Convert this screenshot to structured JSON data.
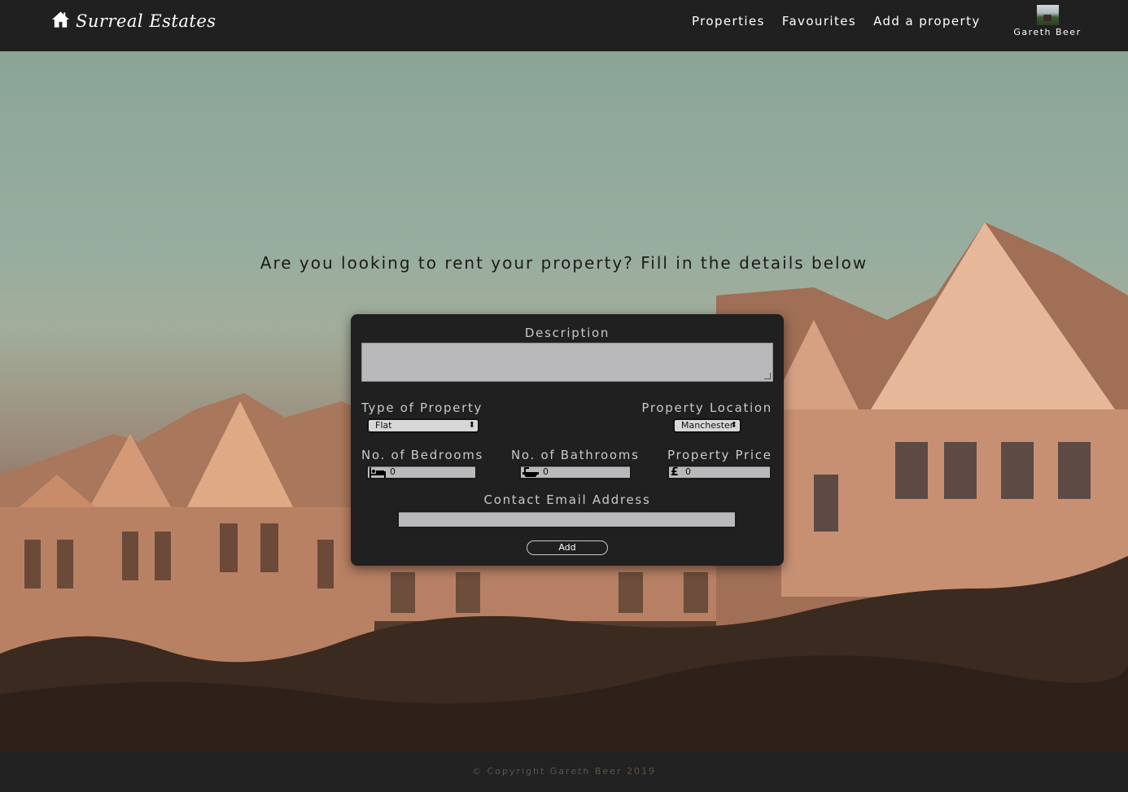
{
  "navbar": {
    "brand": "Surreal Estates",
    "links": [
      "Properties",
      "Favourites",
      "Add a property"
    ],
    "user_name": "Gareth Beer"
  },
  "hero": {
    "headline": "Are you looking to rent your property? Fill in the details below"
  },
  "form": {
    "description_label": "Description",
    "description_value": "",
    "type_label": "Type of Property",
    "type_value": "Flat",
    "location_label": "Property Location",
    "location_value": "Manchester",
    "bedrooms_label": "No. of Bedrooms",
    "bedrooms_value": "0",
    "bathrooms_label": "No. of Bathrooms",
    "bathrooms_value": "0",
    "price_label": "Property Price",
    "price_value": "0",
    "email_label": "Contact Email Address",
    "email_value": "",
    "add_button": "Add"
  },
  "icons": {
    "brand": "home-icon",
    "bedrooms": "bed-icon",
    "bathrooms": "bath-icon",
    "price": "pound-sign-icon"
  },
  "footer": {
    "copyright": "© Copyright Gareth Beer 2019"
  }
}
